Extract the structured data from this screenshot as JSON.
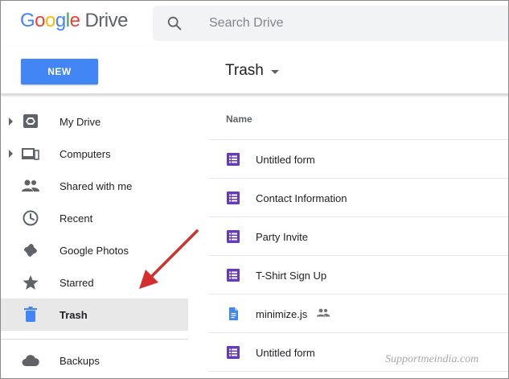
{
  "header": {
    "logo_letters": [
      "G",
      "o",
      "o",
      "g",
      "l",
      "e"
    ],
    "logo_product": "Drive",
    "search_placeholder": "Search Drive"
  },
  "toolbar": {
    "new_label": "NEW",
    "breadcrumb": "Trash"
  },
  "sidebar": {
    "items": [
      {
        "label": "My Drive",
        "icon": "my-drive-icon",
        "expandable": true
      },
      {
        "label": "Computers",
        "icon": "computers-icon",
        "expandable": true
      },
      {
        "label": "Shared with me",
        "icon": "people-icon",
        "expandable": false
      },
      {
        "label": "Recent",
        "icon": "clock-icon",
        "expandable": false
      },
      {
        "label": "Google Photos",
        "icon": "photos-pinwheel-icon",
        "expandable": false
      },
      {
        "label": "Starred",
        "icon": "star-icon",
        "expandable": false
      },
      {
        "label": "Trash",
        "icon": "trash-icon",
        "expandable": false,
        "active": true
      },
      {
        "label": "Backups",
        "icon": "cloud-icon",
        "expandable": false
      }
    ]
  },
  "list": {
    "column_name": "Name",
    "files": [
      {
        "name": "Untitled form",
        "type": "form",
        "shared": false
      },
      {
        "name": "Contact Information",
        "type": "form",
        "shared": false
      },
      {
        "name": "Party Invite",
        "type": "form",
        "shared": false
      },
      {
        "name": "T-Shirt Sign Up",
        "type": "form",
        "shared": false
      },
      {
        "name": "minimize.js",
        "type": "doc",
        "shared": true
      },
      {
        "name": "Untitled form",
        "type": "form",
        "shared": false
      }
    ]
  },
  "watermark": "Supportmeindia.com",
  "colors": {
    "accent_blue": "#4285F4",
    "form_purple": "#673AB7",
    "doc_blue": "#4285F4",
    "annotation_red": "#D32F2F",
    "icon_gray": "#5f6368"
  }
}
